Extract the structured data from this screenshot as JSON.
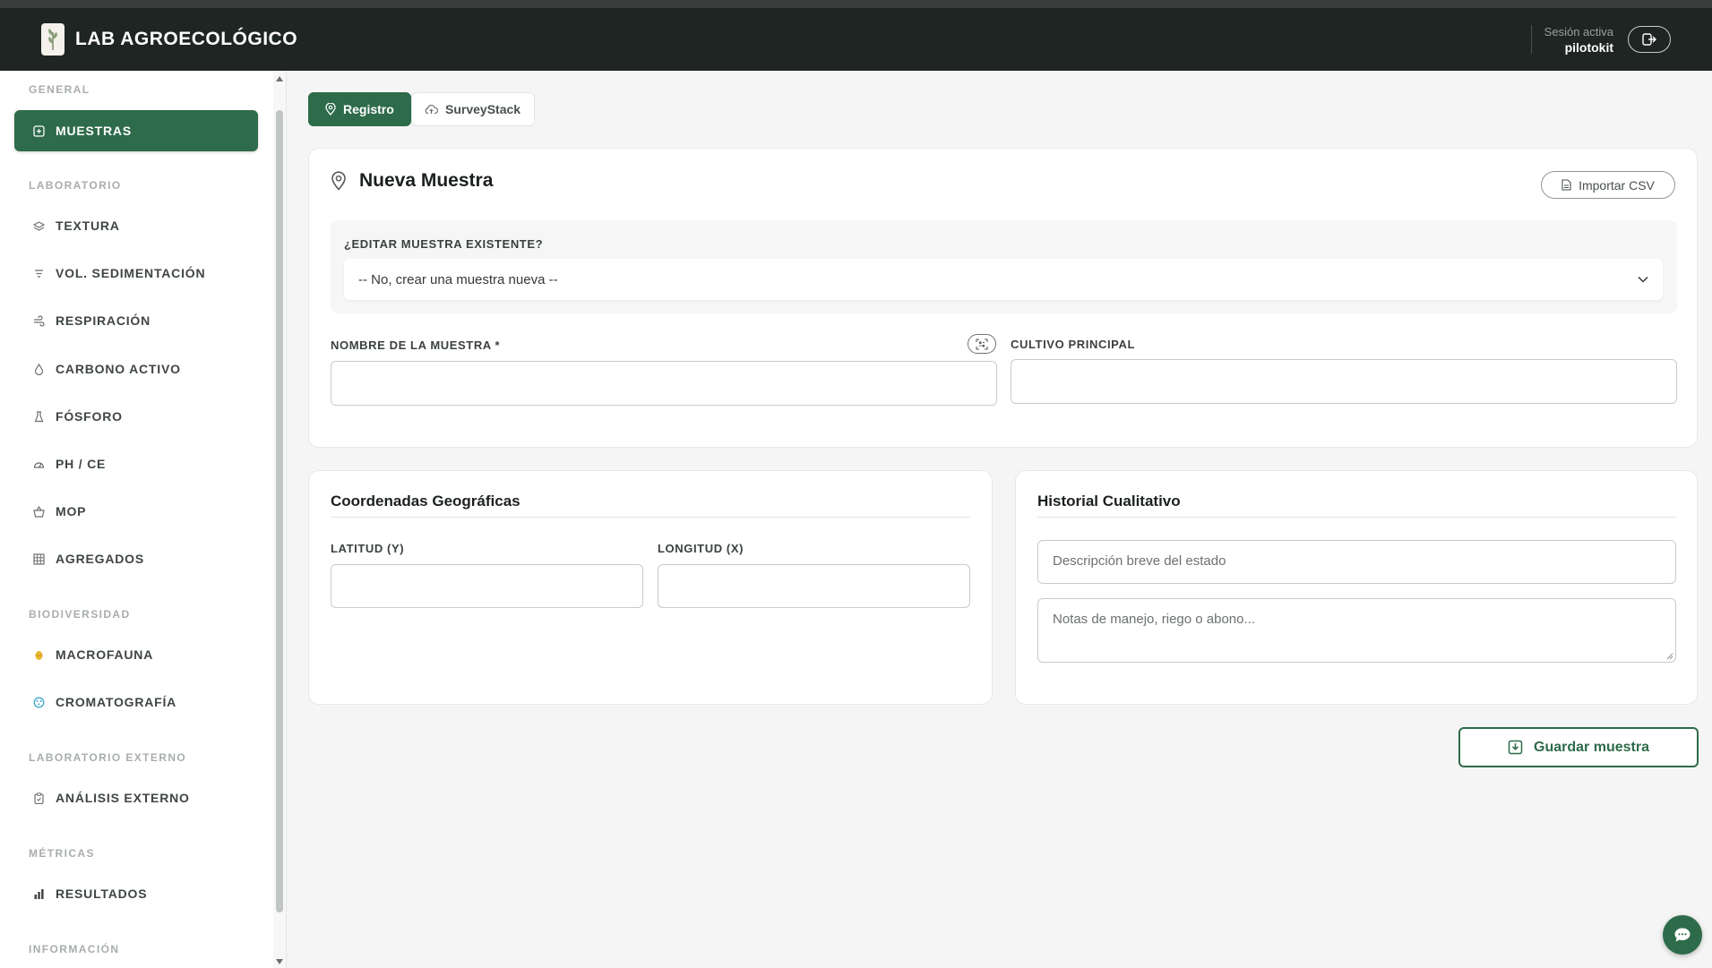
{
  "header": {
    "title": "LAB AGROECOLÓGICO",
    "session_label": "Sesión activa",
    "session_user": "pilotokit"
  },
  "sidebar": {
    "sections": [
      {
        "title": "GENERAL",
        "items": [
          {
            "label": "MUESTRAS",
            "icon": "plus-square-icon",
            "active": true
          }
        ]
      },
      {
        "title": "LABORATORIO",
        "items": [
          {
            "label": "TEXTURA",
            "icon": "layers-icon"
          },
          {
            "label": "VOL. SEDIMENTACIÓN",
            "icon": "filter-icon"
          },
          {
            "label": "RESPIRACIÓN",
            "icon": "wind-icon"
          },
          {
            "label": "CARBONO ACTIVO",
            "icon": "droplet-icon"
          },
          {
            "label": "FÓSFORO",
            "icon": "flask-icon"
          },
          {
            "label": "PH / CE",
            "icon": "gauge-icon"
          },
          {
            "label": "MOP",
            "icon": "basket-icon"
          },
          {
            "label": "AGREGADOS",
            "icon": "grid-icon"
          }
        ]
      },
      {
        "title": "BIODIVERSIDAD",
        "items": [
          {
            "label": "MACROFAUNA",
            "icon": "bug-icon"
          },
          {
            "label": "CROMATOGRAFÍA",
            "icon": "palette-icon"
          }
        ]
      },
      {
        "title": "LABORATORIO EXTERNO",
        "items": [
          {
            "label": "ANÁLISIS EXTERNO",
            "icon": "clipboard-icon"
          }
        ]
      },
      {
        "title": "MÉTRICAS",
        "items": [
          {
            "label": "RESULTADOS",
            "icon": "bar-chart-icon"
          }
        ]
      },
      {
        "title": "INFORMACIÓN",
        "items": []
      }
    ]
  },
  "tabs": [
    {
      "label": "Registro",
      "icon": "map-pin-icon",
      "active": true
    },
    {
      "label": "SurveyStack",
      "icon": "cloud-upload-icon",
      "active": false,
      "status_color": "#2e8b57"
    }
  ],
  "main": {
    "title": "Nueva Muestra",
    "import_label": "Importar CSV",
    "edit_label": "¿EDITAR MUESTRA EXISTENTE?",
    "edit_selected": "-- No, crear una muestra nueva --",
    "sample_name_label": "NOMBRE DE LA MUESTRA *",
    "sample_name_value": "",
    "crop_label": "CULTIVO PRINCIPAL",
    "crop_value": ""
  },
  "coords": {
    "title": "Coordenadas Geográficas",
    "lat_label": "LATITUD (Y)",
    "lat_value": "",
    "lon_label": "LONGITUD (X)",
    "lon_value": ""
  },
  "history": {
    "title": "Historial Cualitativo",
    "state_placeholder": "Descripción breve del estado",
    "notes_placeholder": "Notas de manejo, riego o abono..."
  },
  "actions": {
    "save_label": "Guardar muestra"
  },
  "colors": {
    "accent": "#2e6b4a",
    "header_bg": "#1f2522",
    "page_bg": "#f4f5f4",
    "macrofauna_icon": "#e8b730",
    "cromatografia_icon": "#3aa7c9"
  }
}
